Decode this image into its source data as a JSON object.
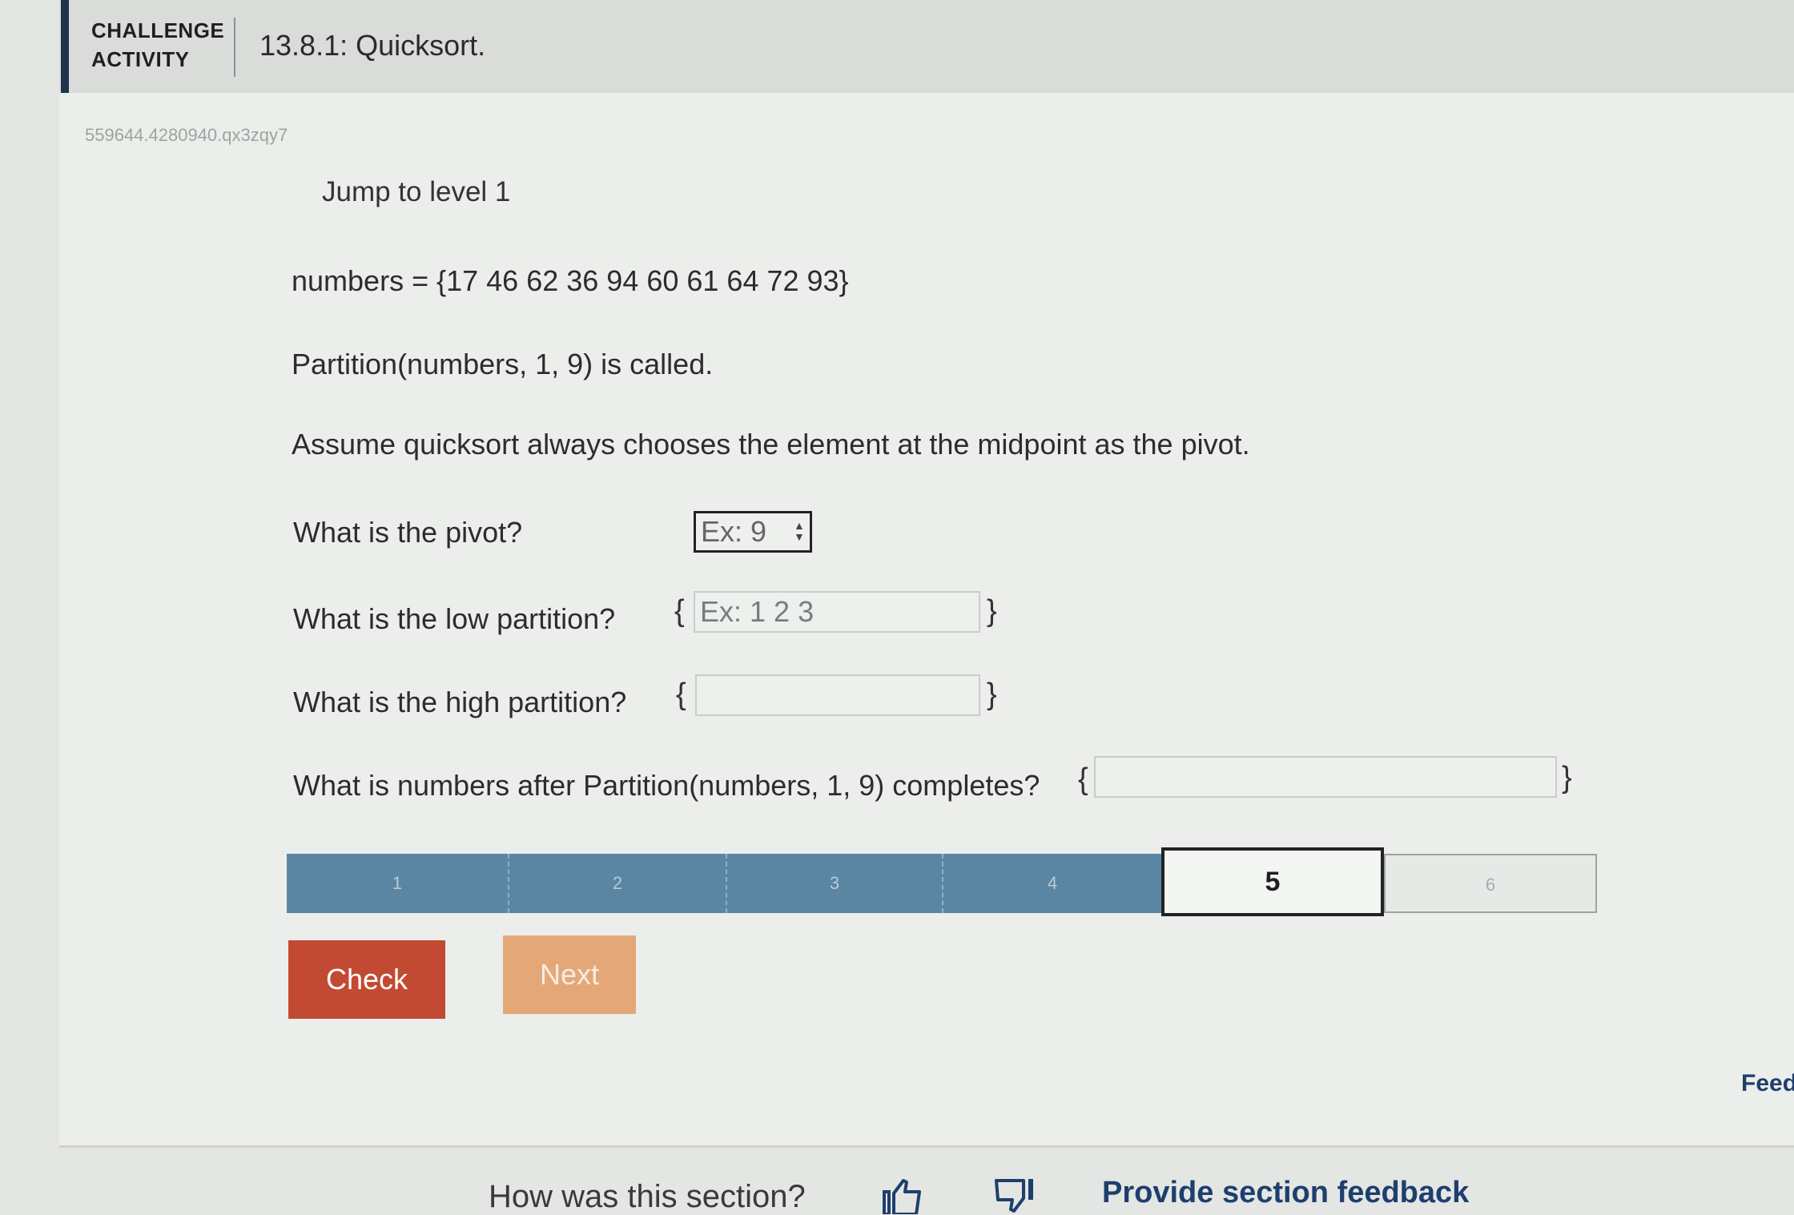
{
  "header": {
    "activity_type": "CHALLENGE\nACTIVITY",
    "title": "13.8.1: Quicksort."
  },
  "activity_id": "559644.4280940.qx3zqy7",
  "jump_label": "Jump to level 1",
  "problem": {
    "numbers_line": "numbers = {17 46 62 36 94 60 61 64 72 93}",
    "call_line": "Partition(numbers, 1, 9) is called.",
    "assumption_line": "Assume quicksort always chooses the element at the midpoint as the pivot."
  },
  "questions": {
    "pivot": {
      "label": "What is the pivot?",
      "placeholder": "Ex: 9"
    },
    "low": {
      "label": "What is the low partition?",
      "placeholder": "Ex: 1 2 3",
      "open": "{",
      "close": "}"
    },
    "high": {
      "label": "What is the high partition?",
      "placeholder": "",
      "open": "{",
      "close": "}"
    },
    "after": {
      "label": "What is numbers after Partition(numbers, 1, 9) completes?",
      "placeholder": "",
      "open": "{",
      "close": "}"
    }
  },
  "levels": [
    {
      "label": "1",
      "state": "done"
    },
    {
      "label": "2",
      "state": "done"
    },
    {
      "label": "3",
      "state": "done"
    },
    {
      "label": "4",
      "state": "done"
    },
    {
      "label": "5",
      "state": "current"
    },
    {
      "label": "6",
      "state": "todo"
    }
  ],
  "buttons": {
    "check": "Check",
    "next": "Next"
  },
  "feedback": {
    "side_label": "Feed",
    "question": "How was this section?",
    "link": "Provide section feedback"
  },
  "colors": {
    "header_accent": "#20344f",
    "level_done": "#5a86a3",
    "check_button": "#c24a32",
    "next_button": "#e4a878",
    "link": "#1e3f6e"
  }
}
